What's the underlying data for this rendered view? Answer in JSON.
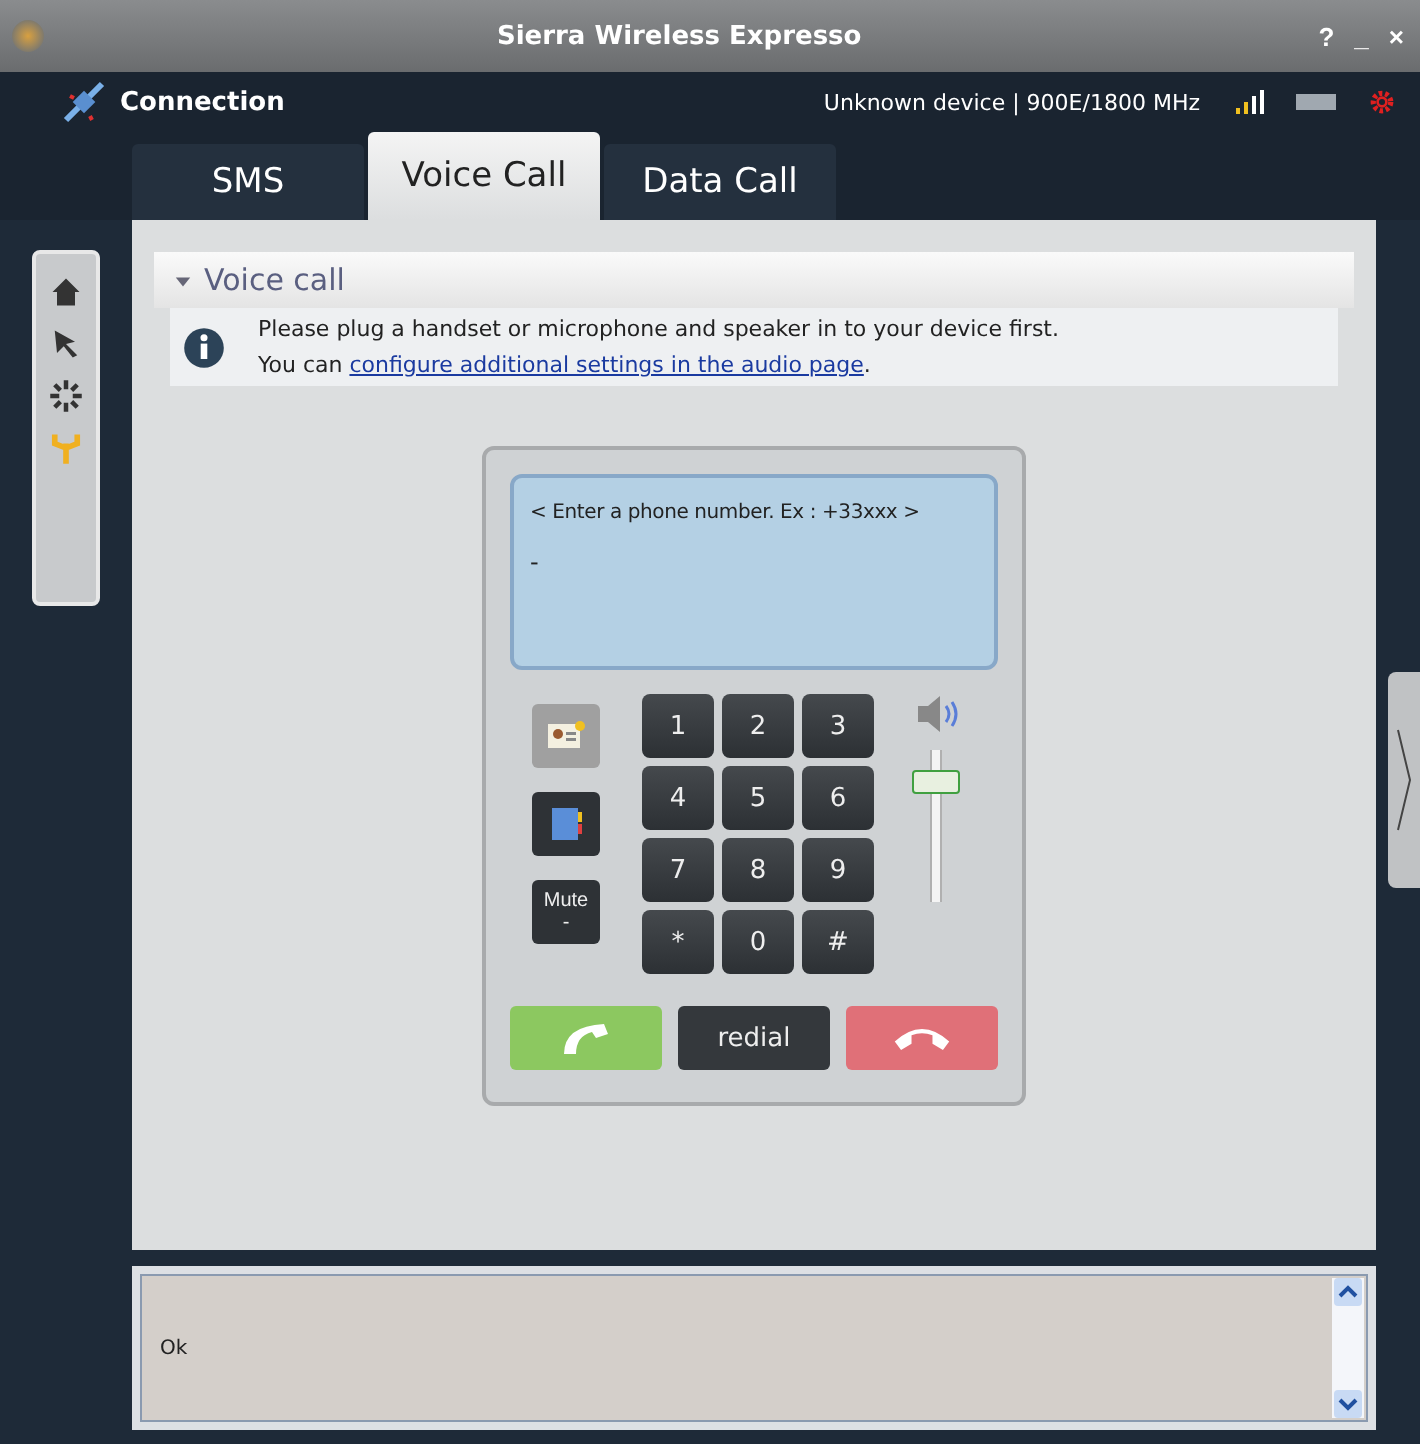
{
  "window": {
    "title": "Sierra Wireless Expresso",
    "controls": [
      "?",
      "_",
      "×"
    ]
  },
  "header": {
    "connection": "Connection",
    "device_status": "Unknown device | 900E/1800 MHz"
  },
  "tabs": [
    {
      "label": "SMS",
      "selected": false
    },
    {
      "label": "Voice Call",
      "selected": true
    },
    {
      "label": "Data Call",
      "selected": false
    }
  ],
  "sidebar": {
    "items": [
      {
        "kind": "home",
        "selected": false
      },
      {
        "kind": "cursor",
        "selected": false
      },
      {
        "kind": "busy",
        "selected": false
      },
      {
        "kind": "antenna",
        "selected": true
      }
    ]
  },
  "section": {
    "title": "Voice call",
    "expanded": true,
    "info_line_1": "Please plug a handset or microphone and speaker in to your device first.",
    "info_prefix": "You can ",
    "info_link": "configure additional settings in the audio page",
    "info_suffix": "."
  },
  "phone": {
    "display_placeholder": "< Enter a phone number. Ex : +33xxx >",
    "display_value": "-",
    "mute_label": "Mute",
    "mute_value": "-",
    "keys": [
      "1",
      "2",
      "3",
      "4",
      "5",
      "6",
      "7",
      "8",
      "9",
      "*",
      "0",
      "#"
    ],
    "volume": {
      "level": 0.85
    },
    "redial": "redial"
  },
  "log": {
    "text": "Ok"
  }
}
